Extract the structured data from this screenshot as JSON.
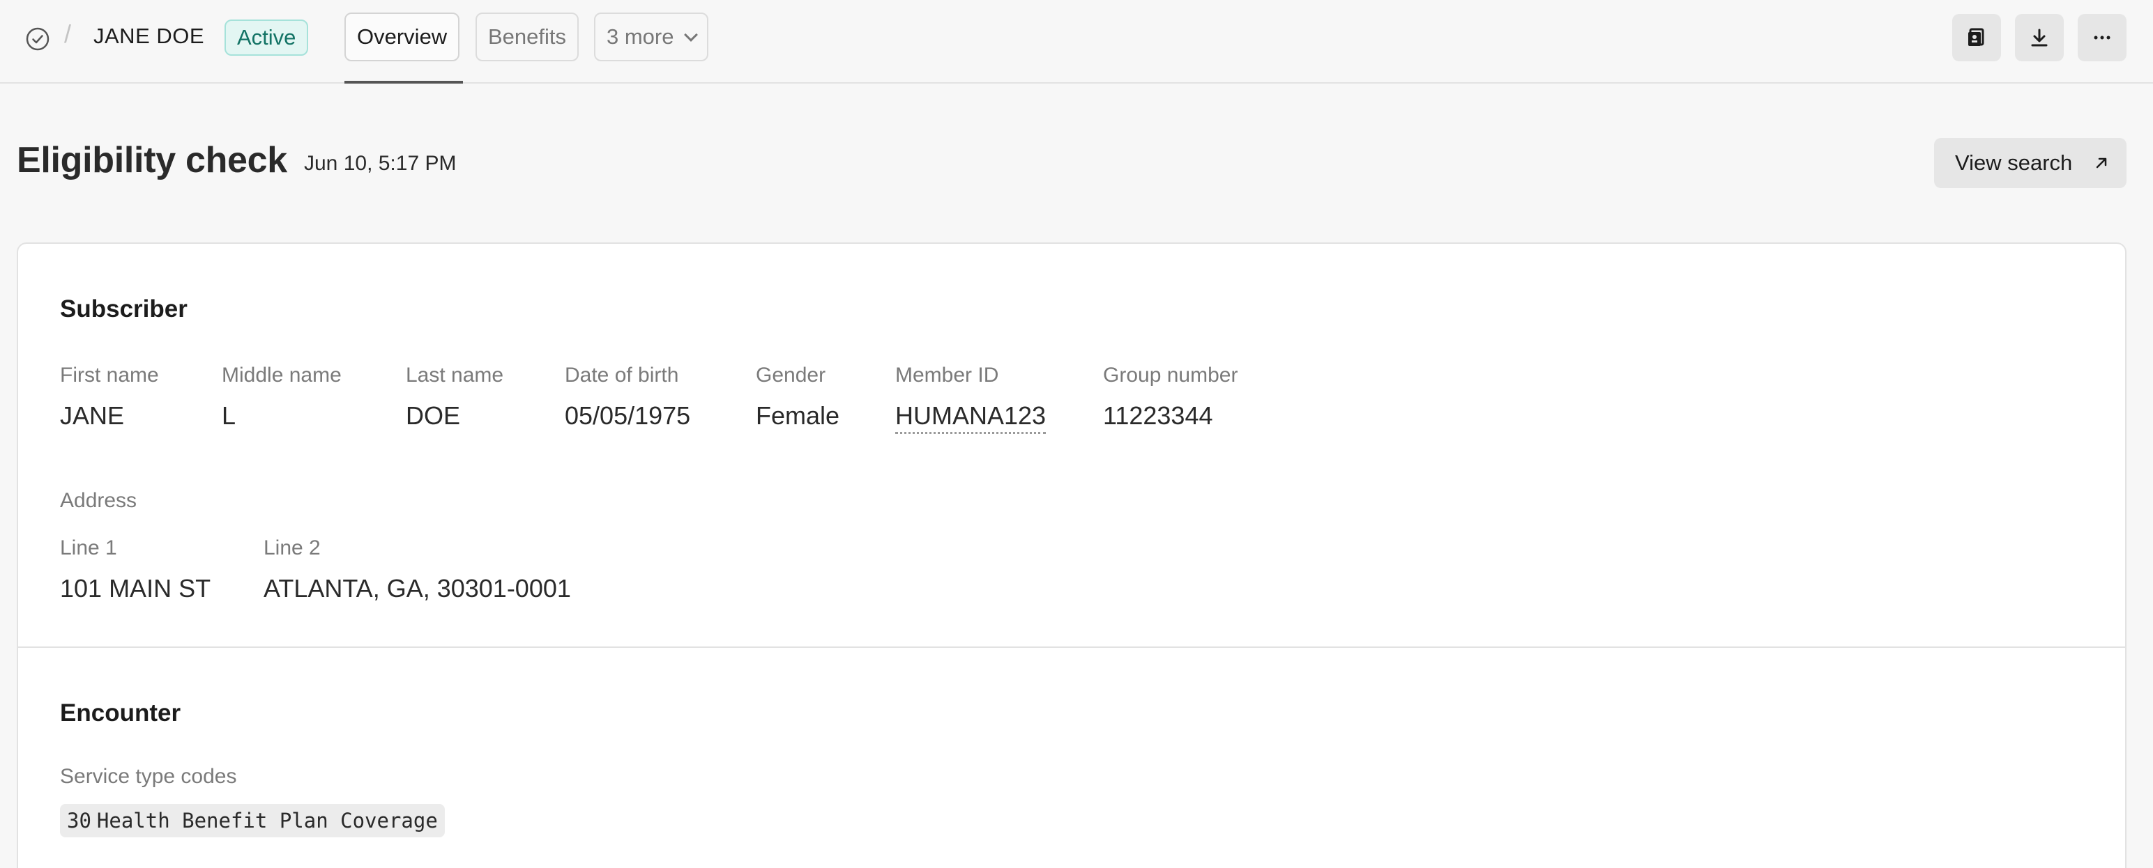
{
  "header": {
    "patient_name": "JANE DOE",
    "status_badge": "Active",
    "separator": "/",
    "tabs": [
      {
        "label": "Overview",
        "active": true
      },
      {
        "label": "Benefits",
        "active": false
      },
      {
        "label": "3 more",
        "active": false,
        "has_dropdown": true
      }
    ],
    "actions": [
      {
        "icon": "id-card-icon"
      },
      {
        "icon": "download-icon"
      },
      {
        "icon": "more-horizontal-icon"
      }
    ]
  },
  "page": {
    "title": "Eligibility check",
    "timestamp": "Jun 10, 5:17 PM",
    "view_search_label": "View search"
  },
  "subscriber": {
    "heading": "Subscriber",
    "fields": [
      {
        "label": "First name",
        "value": "JANE"
      },
      {
        "label": "Middle name",
        "value": "L"
      },
      {
        "label": "Last name",
        "value": "DOE"
      },
      {
        "label": "Date of birth",
        "value": "05/05/1975"
      },
      {
        "label": "Gender",
        "value": "Female"
      },
      {
        "label": "Member ID",
        "value": "HUMANA123"
      },
      {
        "label": "Group number",
        "value": "11223344"
      }
    ],
    "address": {
      "heading": "Address",
      "fields": [
        {
          "label": "Line 1",
          "value": "101 MAIN ST"
        },
        {
          "label": "Line 2",
          "value": "ATLANTA, GA, 30301-0001"
        }
      ]
    }
  },
  "encounter": {
    "heading": "Encounter",
    "service_type_label": "Service type codes",
    "service_types": [
      {
        "code": "30",
        "description": "Health Benefit Plan Coverage"
      }
    ]
  },
  "colors": {
    "accent_badge_bg": "#e3f6f3",
    "accent_badge_text": "#137365",
    "background": "#f7f7f7",
    "card": "#ffffff"
  }
}
